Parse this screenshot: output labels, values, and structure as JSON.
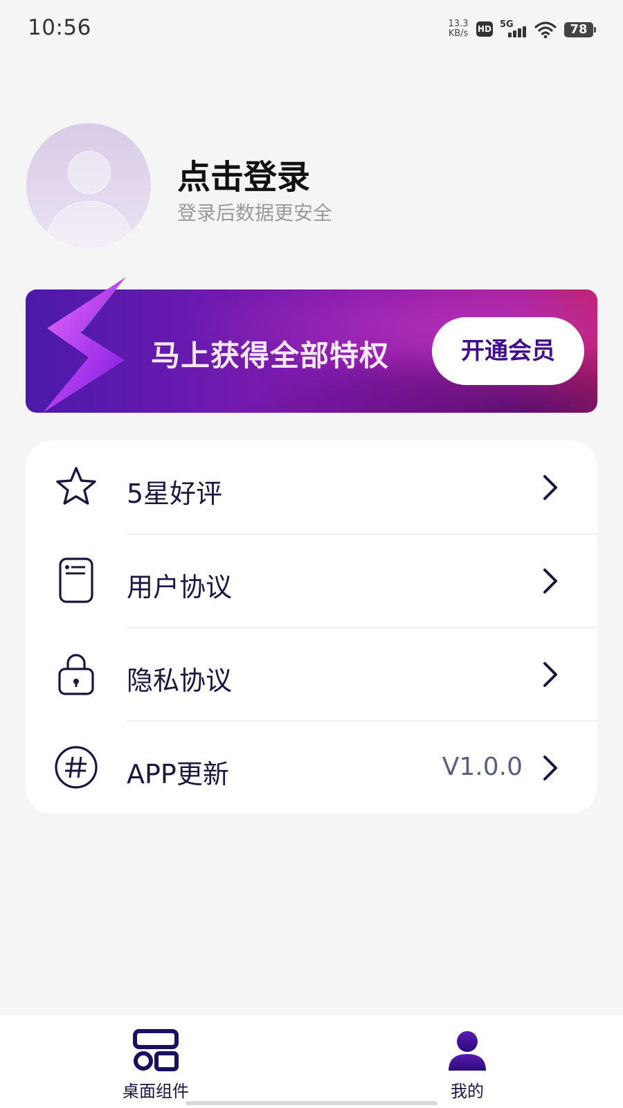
{
  "status_bar": {
    "time": "10:56",
    "net_speed_value": "13.3",
    "net_speed_unit": "KB/s",
    "hd_badge": "HD",
    "network": "5G",
    "battery": "78"
  },
  "profile": {
    "title": "点击登录",
    "subtitle": "登录后数据更安全"
  },
  "vip_banner": {
    "text": "马上获得全部特权",
    "button": "开通会员"
  },
  "menu": [
    {
      "label": "5星好评",
      "icon": "star-icon",
      "value": ""
    },
    {
      "label": "用户协议",
      "icon": "document-icon",
      "value": ""
    },
    {
      "label": "隐私协议",
      "icon": "lock-icon",
      "value": ""
    },
    {
      "label": "APP更新",
      "icon": "hash-icon",
      "value": "V1.0.0"
    }
  ],
  "bottom_nav": {
    "widgets": "桌面组件",
    "mine": "我的"
  },
  "colors": {
    "accent": "#1a1540",
    "vip_start": "#4a1aa8",
    "vip_end": "#c0206a",
    "background": "#f5f5f5"
  }
}
